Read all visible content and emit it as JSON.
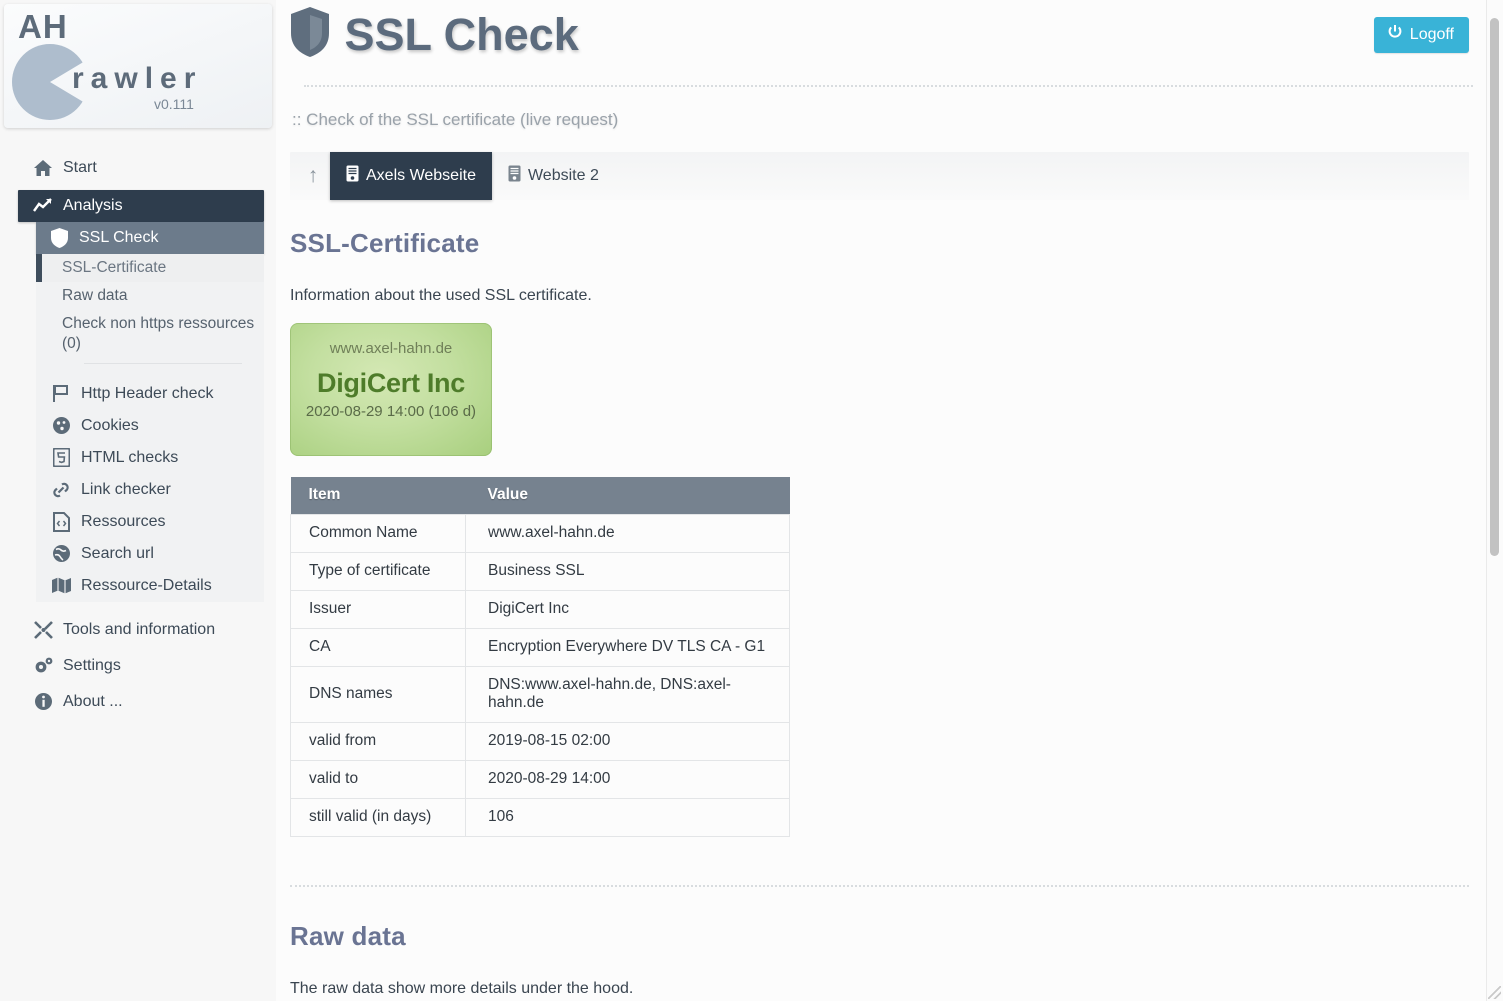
{
  "brand": {
    "title_top": "AH",
    "title_main": "rawler",
    "version": "v0.111"
  },
  "header": {
    "title": "SSL Check",
    "shield_icon": "shield-icon",
    "logoff_label": "Logoff",
    "logoff_icon": "power-icon",
    "logoff_color": "#39b3d7",
    "subtitle": ":: Check of the SSL certificate (live request)"
  },
  "tabs": {
    "up_icon": "arrow-up-icon",
    "items": [
      {
        "label": "Axels Webseite",
        "icon": "server-icon",
        "active": true
      },
      {
        "label": "Website 2",
        "icon": "server-icon",
        "active": false
      }
    ]
  },
  "sidebar": {
    "items": [
      {
        "label": "Start",
        "icon": "home-icon",
        "level": 0
      },
      {
        "label": "Analysis",
        "icon": "chart-line-icon",
        "level": 0,
        "state": "active-parent"
      },
      {
        "label": "SSL Check",
        "icon": "shield-icon",
        "level": 1,
        "state": "active"
      }
    ],
    "subitems": [
      {
        "label": "SSL-Certificate",
        "active": true
      },
      {
        "label": "Raw data",
        "active": false
      },
      {
        "label": "Check non https ressources (0)",
        "active": false
      }
    ],
    "group_items": [
      {
        "label": "Http Header check",
        "icon": "flag-icon"
      },
      {
        "label": "Cookies",
        "icon": "cookie-icon"
      },
      {
        "label": "HTML checks",
        "icon": "html5-icon"
      },
      {
        "label": "Link checker",
        "icon": "link-icon"
      },
      {
        "label": "Ressources",
        "icon": "file-code-icon"
      },
      {
        "label": "Search url",
        "icon": "globe-icon"
      },
      {
        "label": "Ressource-Details",
        "icon": "map-icon"
      }
    ],
    "bottom_items": [
      {
        "label": "Tools and information",
        "icon": "tools-icon"
      },
      {
        "label": "Settings",
        "icon": "gears-icon"
      },
      {
        "label": "About ...",
        "icon": "info-icon"
      }
    ]
  },
  "main": {
    "section_title": "SSL-Certificate",
    "intro": "Information about the used SSL certificate.",
    "badge": {
      "host": "www.axel-hahn.de",
      "issuer": "DigiCert Inc",
      "valid_line": "2020-08-29 14:00 (106 d)",
      "color": "#b6d793"
    },
    "table": {
      "headers": [
        "Item",
        "Value"
      ],
      "rows": [
        [
          "Common Name",
          "www.axel-hahn.de"
        ],
        [
          "Type of certificate",
          "Business SSL"
        ],
        [
          "Issuer",
          "DigiCert Inc"
        ],
        [
          "CA",
          "Encryption Everywhere DV TLS CA - G1"
        ],
        [
          "DNS names",
          "DNS:www.axel-hahn.de, DNS:axel-hahn.de"
        ],
        [
          "valid from",
          "2019-08-15 02:00"
        ],
        [
          "valid to",
          "2020-08-29 14:00"
        ],
        [
          "still valid (in days)",
          "106"
        ]
      ]
    },
    "raw_title": "Raw data",
    "raw_intro": "The raw data show more details under the hood."
  }
}
